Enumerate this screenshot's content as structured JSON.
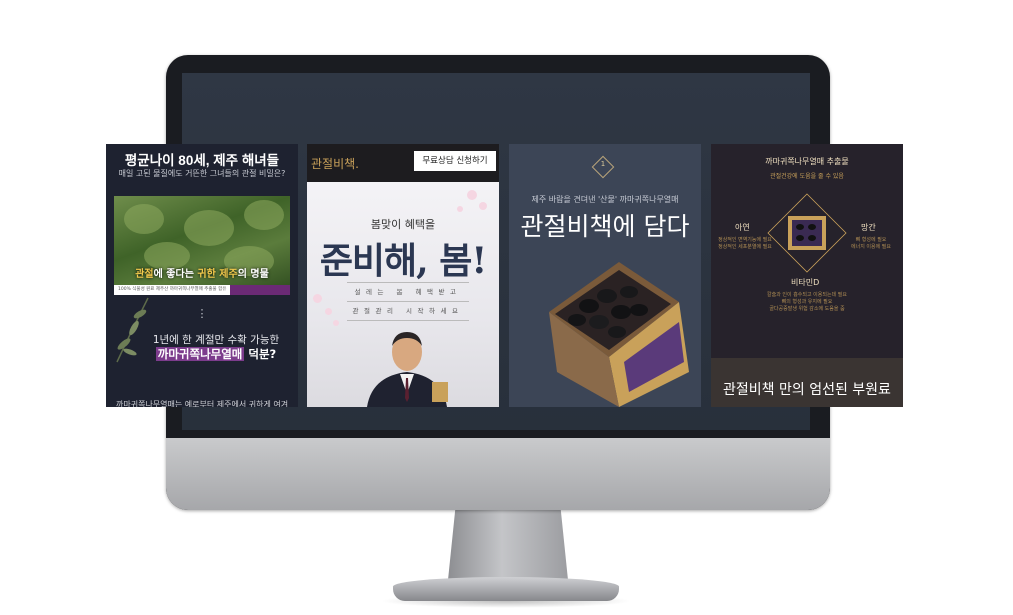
{
  "card1": {
    "title": "평균나이 80세, 제주 해녀들",
    "subtitle": "매일 고된 물질에도 거뜬한 그녀들의 관절 비밀은?",
    "caption_a": "관절",
    "caption_b": "에 좋다는 ",
    "caption_c": "귀한 제주",
    "caption_d": "의 명물",
    "strip_text": "100% 식물성 원료 제주산 까마귀쪽나무열매 추출물 함유",
    "dots": "⋮",
    "line1": "1년에 한 계절만 수확 가능한",
    "line2_mark": "까마귀쪽나무열매",
    "line2_rest": " 덕분?",
    "bottom_text": "까마귀쪽나무열매는 예로부터 제주에서 귀하게 여겨"
  },
  "card2": {
    "brand": "관절비책.",
    "consult_button": "무료상담 신청하기",
    "small_headline": "봄맞이 혜택을",
    "big_headline": "준비해, 봄!",
    "grid_row1": "설레는 봄 혜택받고",
    "grid_row2": "관절관리 시작하세요"
  },
  "card3": {
    "badge": "1",
    "sub": "제주 바람을 견뎌낸 '산물' 까마귀쪽나무열매",
    "headline": "관절비책에 담다"
  },
  "card4": {
    "title": "까마귀쪽나무열매 추출물",
    "sub": "관절건강에 도움을 줄 수 있음",
    "label_left": "아연",
    "label_right": "망간",
    "label_bottom": "비타민D",
    "desc_left": "정상적인 면역기능에 필요\n정상적인 세포분열에 필요",
    "desc_right": "뼈 형성에 필요\n에너지 이용에 필요",
    "desc_bottom": "칼슘과 인이 흡수되고 이용되는데 필요\n뼈의 형성과 유지에 필요\n골다공증발생 위험 감소에 도움을 줌",
    "bottom_title": "관절비책 만의 엄선된 부원료"
  },
  "colors": {
    "accent_purple": "#7c3c8c",
    "gold": "#c9a15a",
    "navy": "#2b3752"
  }
}
